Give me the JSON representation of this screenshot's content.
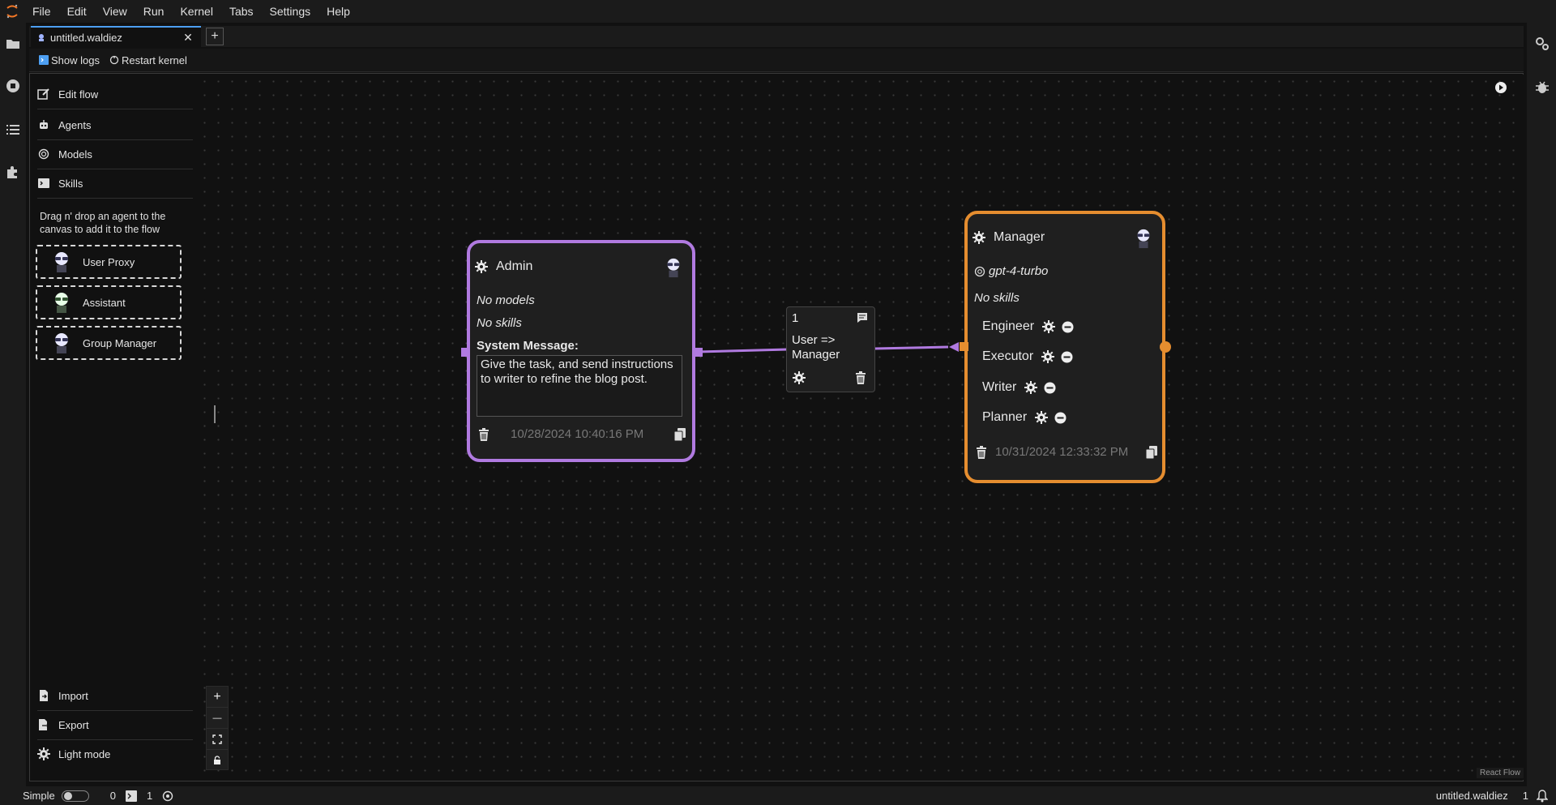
{
  "menubar": {
    "items": [
      "File",
      "Edit",
      "View",
      "Run",
      "Kernel",
      "Tabs",
      "Settings",
      "Help"
    ]
  },
  "tabs": {
    "active_label": "untitled.waldiez",
    "add_label": "+"
  },
  "toolbar": {
    "show_logs": "Show logs",
    "restart_kernel": "Restart kernel"
  },
  "sidebar": {
    "items": [
      {
        "label": "Edit flow",
        "icon": "edit-icon"
      },
      {
        "label": "Agents",
        "icon": "robot-icon"
      },
      {
        "label": "Models",
        "icon": "openai-icon"
      },
      {
        "label": "Skills",
        "icon": "terminal-icon"
      }
    ],
    "hint": "Drag n' drop an agent to the canvas to add it to the flow",
    "agents": [
      {
        "label": "User Proxy",
        "icon": "agent-avatar-icon"
      },
      {
        "label": "Assistant",
        "icon": "agent-avatar-icon"
      },
      {
        "label": "Group Manager",
        "icon": "agent-avatar-icon"
      }
    ],
    "bottom": [
      {
        "label": "Import",
        "icon": "import-icon"
      },
      {
        "label": "Export",
        "icon": "export-icon"
      },
      {
        "label": "Light mode",
        "icon": "gear-icon"
      }
    ]
  },
  "nodes": {
    "admin": {
      "title": "Admin",
      "models": "No models",
      "skills": "No skills",
      "system_message_label": "System Message:",
      "system_message": "Give the task, and send instructions to writer to refine the blog post.",
      "date": "10/28/2024 10:40:16 PM",
      "border_color": "#b07ae0"
    },
    "manager": {
      "title": "Manager",
      "model": "gpt-4-turbo",
      "skills": "No skills",
      "members": [
        "Engineer",
        "Executor",
        "Writer",
        "Planner"
      ],
      "date": "10/31/2024 12:33:32 PM",
      "border_color": "#e58d2f"
    }
  },
  "edge": {
    "order": "1",
    "label": "User => Manager"
  },
  "controls": {
    "zoom_in": "+",
    "zoom_out": "—"
  },
  "attribution": "React Flow",
  "statusbar": {
    "mode": "Simple",
    "count_a": "0",
    "count_b": "1",
    "filename": "untitled.waldiez",
    "right_count": "1"
  }
}
